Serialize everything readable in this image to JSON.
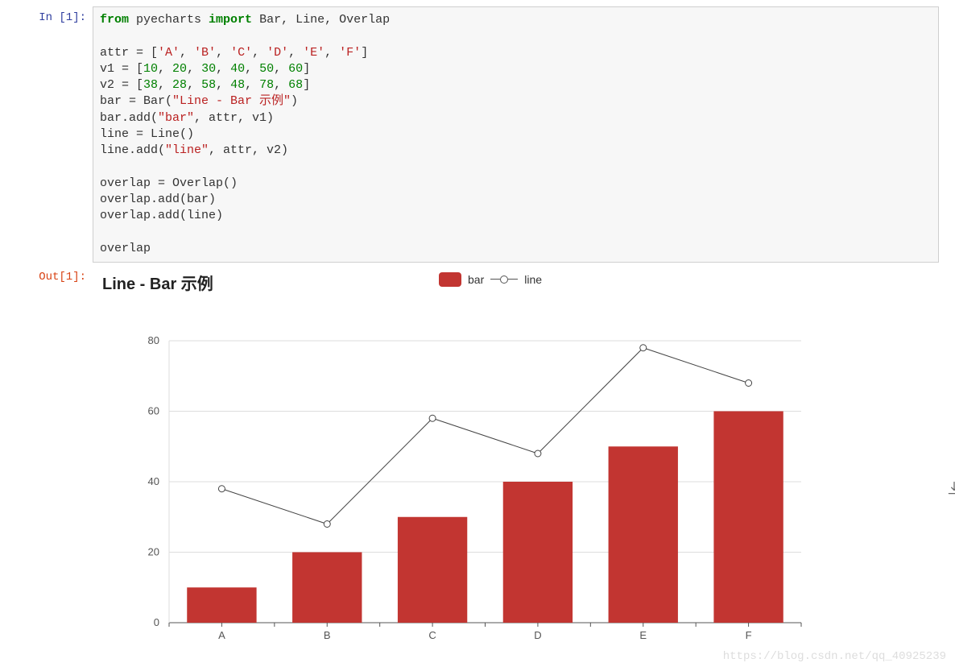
{
  "input_prompt": "In [1]:",
  "output_prompt": "Out[1]:",
  "code": {
    "l1a": "from",
    "l1b": " pyecharts ",
    "l1c": "import",
    "l1d": " Bar, Line, Overlap",
    "l3a": "attr = [",
    "l3v": [
      "'A'",
      "'B'",
      "'C'",
      "'D'",
      "'E'",
      "'F'"
    ],
    "l3b": "]",
    "l4a": "v1 = [",
    "l4v": [
      "10",
      "20",
      "30",
      "40",
      "50",
      "60"
    ],
    "l4b": "]",
    "l5a": "v2 = [",
    "l5v": [
      "38",
      "28",
      "58",
      "48",
      "78",
      "68"
    ],
    "l5b": "]",
    "l6a": "bar = Bar(",
    "l6s": "\"Line - Bar 示例\"",
    "l6b": ")",
    "l7a": "bar.add(",
    "l7s": "\"bar\"",
    "l7b": ", attr, v1)",
    "l8": "line = Line()",
    "l9a": "line.add(",
    "l9s": "\"line\"",
    "l9b": ", attr, v2)",
    "l11": "overlap = Overlap()",
    "l12": "overlap.add(bar)",
    "l13": "overlap.add(line)",
    "l15": "overlap"
  },
  "chart_data": {
    "type": "bar+line",
    "title": "Line - Bar 示例",
    "categories": [
      "A",
      "B",
      "C",
      "D",
      "E",
      "F"
    ],
    "series": [
      {
        "name": "bar",
        "type": "bar",
        "values": [
          10,
          20,
          30,
          40,
          50,
          60
        ],
        "color": "#c23531"
      },
      {
        "name": "line",
        "type": "line",
        "values": [
          38,
          28,
          58,
          48,
          78,
          68
        ],
        "color": "#444"
      }
    ],
    "y_ticks": [
      0,
      20,
      40,
      60,
      80
    ],
    "ylim": [
      0,
      80
    ],
    "xlabel": "",
    "ylabel": ""
  },
  "legend": {
    "bar": "bar",
    "line": "line"
  },
  "watermark": "https://blog.csdn.net/qq_40925239"
}
